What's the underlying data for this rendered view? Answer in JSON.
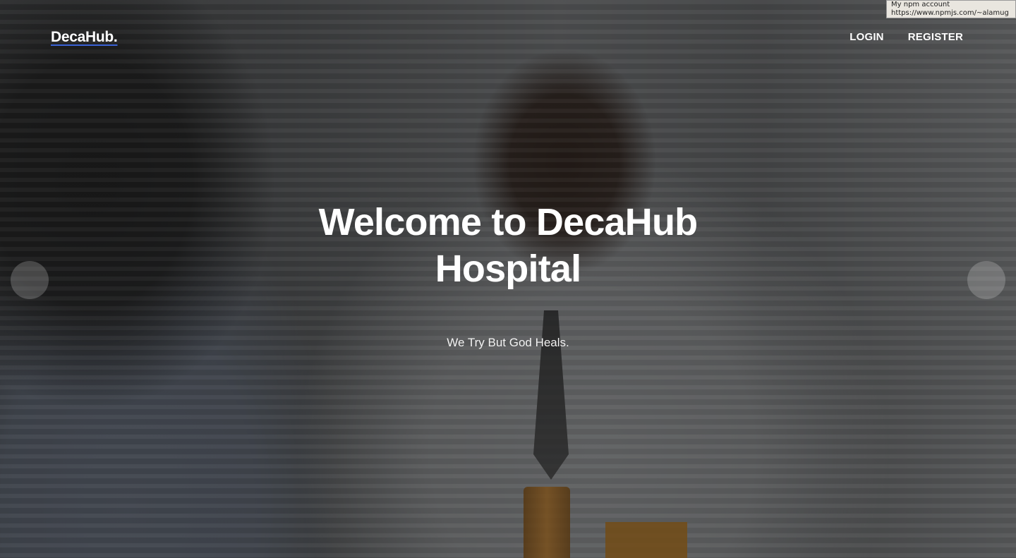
{
  "header": {
    "brand": "DecaHub.",
    "nav": [
      {
        "label": "LOGIN"
      },
      {
        "label": "REGISTER"
      }
    ]
  },
  "tooltip": {
    "title": "My npm account",
    "url": "https://www.npmjs.com/~alamug"
  },
  "hero": {
    "headline_line1": "Welcome to DecaHub",
    "headline_line2": "Hospital",
    "tagline": "We Try But God Heals."
  },
  "carousel": {
    "prev_icon": "carousel-prev-icon",
    "next_icon": "carousel-next-icon"
  },
  "colors": {
    "brand_underline": "#3b63d6",
    "text": "#ffffff"
  }
}
